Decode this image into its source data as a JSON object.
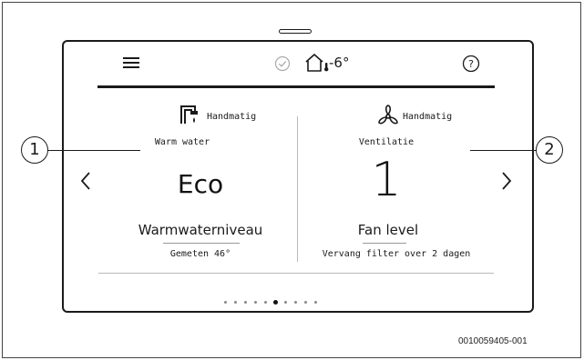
{
  "header": {
    "menu_icon": "hamburger-menu-icon",
    "status_icon": "check-circle-icon",
    "home_icon": "house-thermometer-icon",
    "outdoor_temperature": "-6°",
    "help_icon": "help-circle-icon"
  },
  "left_panel": {
    "icon": "faucet-icon",
    "mode": "Handmatig",
    "category": "Warm water",
    "value": "Eco",
    "parameter": "Warmwaterniveau",
    "detail": "Gemeten 46°"
  },
  "right_panel": {
    "icon": "fan-icon",
    "mode": "Handmatig",
    "category": "Ventilatie",
    "value": "1",
    "parameter": "Fan level",
    "detail": "Vervang filter over 2 dagen"
  },
  "navigation": {
    "prev_icon": "chevron-left-icon",
    "next_icon": "chevron-right-icon"
  },
  "pagination": {
    "total": 10,
    "active_index": 5
  },
  "callouts": {
    "left": "1",
    "right": "2"
  },
  "document_code": "0010059405-001"
}
